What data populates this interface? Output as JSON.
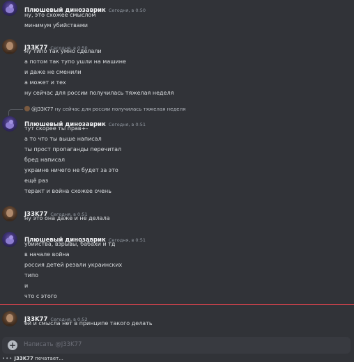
{
  "messages": [
    {
      "author": "Плюшевый динозаврик",
      "time": "Сегодня, в 0:50",
      "lines": [
        "ну, это схожее смыслом",
        "минимум убийствами"
      ]
    },
    {
      "author": "J33K77",
      "time": "Сегодня, в 0:50",
      "lines": [
        "ну типо так умно сделали",
        "а потом так тупо ушли на машине",
        "и даже не сменили",
        "а может и тех",
        "ну сейчас для россии получилась тяжелая неделя"
      ]
    },
    {
      "reply_author": "@J33K77",
      "reply_text": "ну сейчас для россии получилась тяжелая неделя",
      "author": "Плюшевый динозаврик",
      "time": "Сегодня, в 0:51",
      "lines": [
        "тут скорее ты прав+-",
        "а то что ты выше написал",
        "ты прост пропаганды перечитал",
        "бред написал",
        "украине ничего не будет за это",
        "ещё раз",
        "теракт и война схожее очень"
      ]
    },
    {
      "author": "J33K77",
      "time": "Сегодня, в 0:51",
      "lines": [
        "ну это она даже и не делала"
      ]
    },
    {
      "author": "Плюшевый динозаврик",
      "time": "Сегодня, в 0:51",
      "lines": [
        "убийства, взрывы, бабахи и тд",
        "в начале война",
        "россия детей резали украинских",
        "типо",
        "и",
        "что с этого"
      ]
    },
    {
      "author": "J33K77",
      "time": "Сегодня, в 0:52",
      "lines": [
        "ей и смысла нет в принципе такого делать"
      ]
    }
  ],
  "composer": {
    "placeholder": "Написать @J33K77",
    "plus_symbol": "+"
  },
  "typing": {
    "dots": "•••",
    "user": "J33K77",
    "text": "печатает..."
  },
  "colors": {
    "background": "#313338",
    "unread_divider": "#c8414b",
    "author": "#f2f3f5",
    "timestamp": "#949ba4"
  }
}
